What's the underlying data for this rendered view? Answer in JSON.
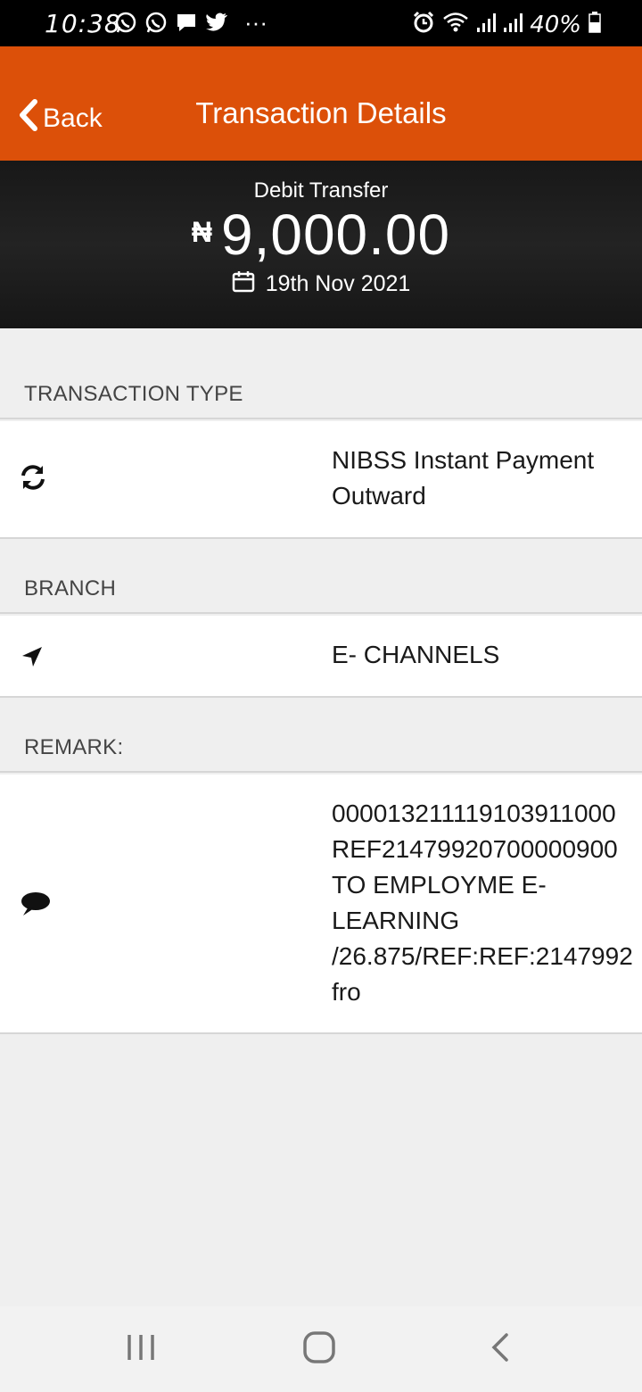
{
  "status_bar": {
    "time": "10:38",
    "battery": "40%",
    "overflow": "···"
  },
  "header": {
    "back_label": "Back",
    "title": "Transaction Details",
    "color": "#dc5009"
  },
  "summary": {
    "type": "Debit Transfer",
    "currency_symbol": "₦",
    "amount": "9,000.00",
    "date": "19th Nov 2021"
  },
  "sections": {
    "transaction_type": {
      "label": "TRANSACTION TYPE",
      "value": "NIBSS Instant Payment Outward",
      "icon": "refresh-icon"
    },
    "branch": {
      "label": "BRANCH",
      "value": "E- CHANNELS",
      "icon": "location-arrow-icon"
    },
    "remark": {
      "label": "REMARK:",
      "value": "000013211119103911000\nREF21479920700000900\nTO EMPLOYME E-\nLEARNING\n/26.875/REF:REF:2147992\nfro",
      "icon": "comment-icon"
    }
  },
  "nav": {
    "recents_icon": "recents-icon",
    "home_icon": "home-icon",
    "back_icon": "back-icon"
  }
}
